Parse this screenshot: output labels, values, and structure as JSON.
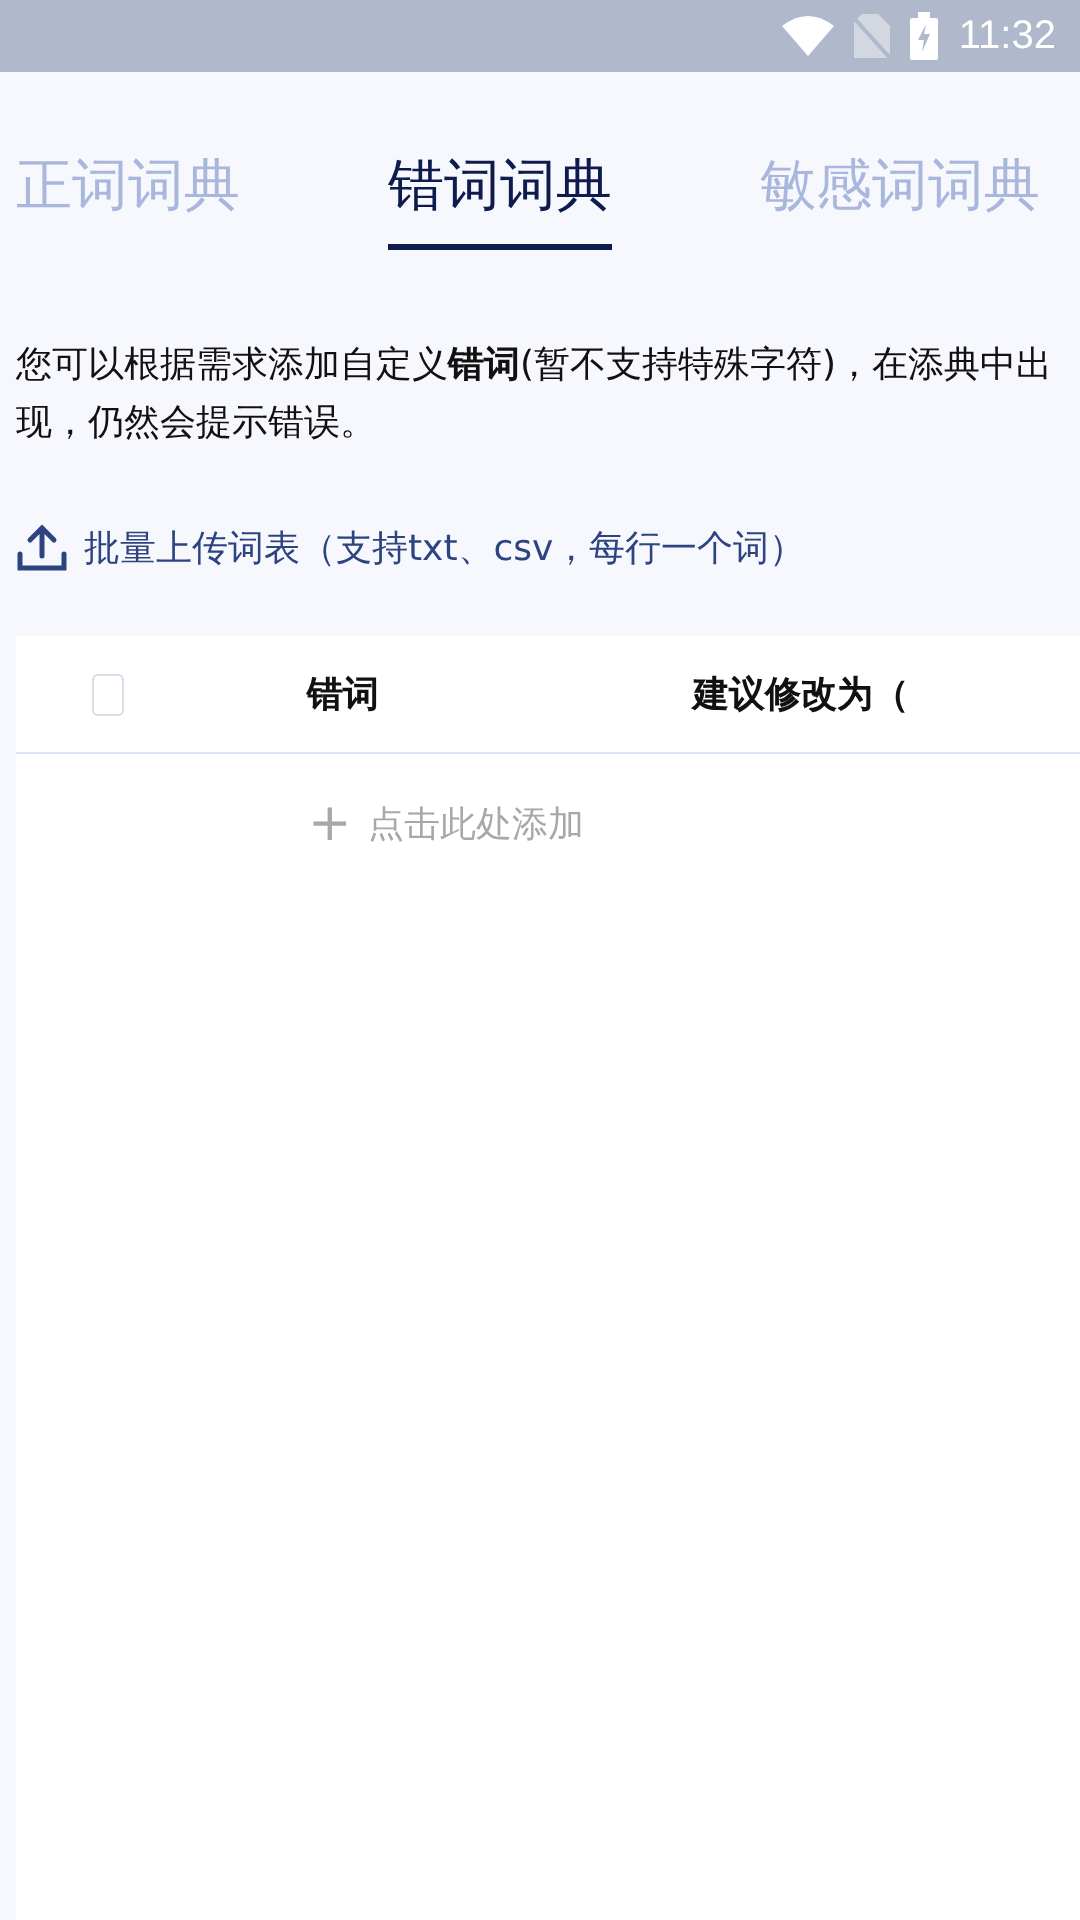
{
  "status_bar": {
    "time": "11:32"
  },
  "tabs": [
    {
      "label": "正词词典",
      "selected": false
    },
    {
      "label": "错词词典",
      "selected": true
    },
    {
      "label": "敏感词词典",
      "selected": false
    }
  ],
  "description": "您可以根据需求添加自定义**错词**(暂不支持特殊字符)，在添典中出现，仍然会提示错误。",
  "upload_link": "批量上传词表（支持txt、csv，每行一个词）",
  "table": {
    "select_all": {
      "checked": false
    },
    "columns": [
      "错词",
      "建议修改为（"
    ],
    "add_row": {
      "icon": "+",
      "label": "点击此处添加"
    }
  }
}
